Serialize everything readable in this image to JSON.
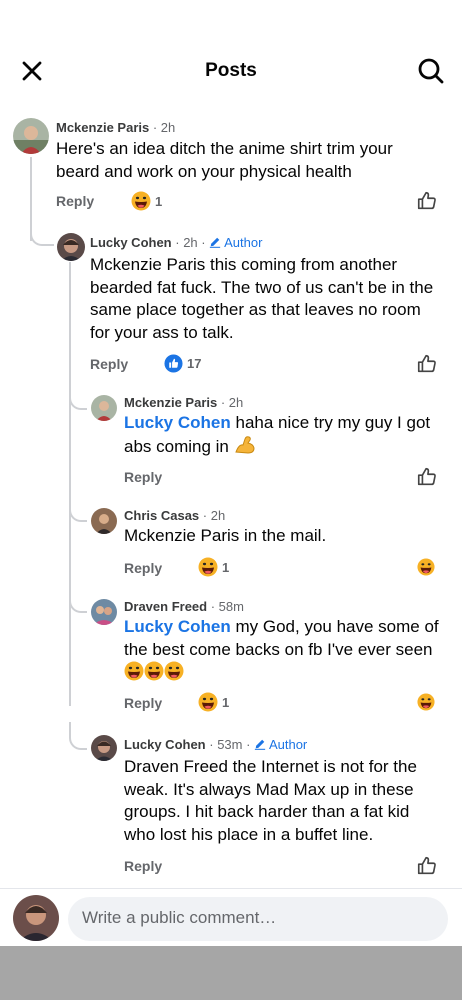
{
  "header": {
    "title": "Posts"
  },
  "comments": [
    {
      "name": "Mckenzie Paris",
      "time": "2h",
      "text": "Here's an idea ditch the anime shirt trim your beard and work on your physical health",
      "reply": "Reply",
      "reaction_count": "1"
    },
    {
      "name": "Lucky Cohen",
      "time": "2h",
      "author": "Author",
      "text": "Mckenzie Paris this coming from another bearded fat fuck. The two of us can't be in the same place together as that leaves no room for your ass to talk.",
      "reply": "Reply",
      "reaction_count": "17"
    },
    {
      "name": "Mckenzie Paris",
      "time": "2h",
      "mention": "Lucky Cohen",
      "text": "haha nice try my guy I got abs coming in",
      "reply": "Reply"
    },
    {
      "name": "Chris Casas",
      "time": "2h",
      "text": "Mckenzie Paris in the mail.",
      "reply": "Reply",
      "reaction_count": "1"
    },
    {
      "name": "Draven Freed",
      "time": "58m",
      "mention": "Lucky Cohen",
      "text": "my God, you have some of the best come backs on fb I've ever seen",
      "reply": "Reply",
      "reaction_count": "1"
    },
    {
      "name": "Lucky Cohen",
      "time": "53m",
      "author": "Author",
      "text": "Draven Freed the Internet is not for the weak. It's always Mad Max up in these groups. I hit back harder than a fat kid who lost his place in a buffet line.",
      "reply": "Reply"
    }
  ],
  "composer": {
    "placeholder": "Write a public comment…"
  },
  "colors": {
    "accent": "#1b74e4",
    "secondary_text": "#65676b",
    "thread_line": "#ced0d4",
    "bottom_bar": "#a6a6a6"
  },
  "icons": [
    "close-icon",
    "search-icon",
    "like-icon",
    "haha-reaction-icon",
    "like-reaction-icon",
    "pencil-icon",
    "flexed-biceps-emoji",
    "tears-of-joy-emoji"
  ]
}
